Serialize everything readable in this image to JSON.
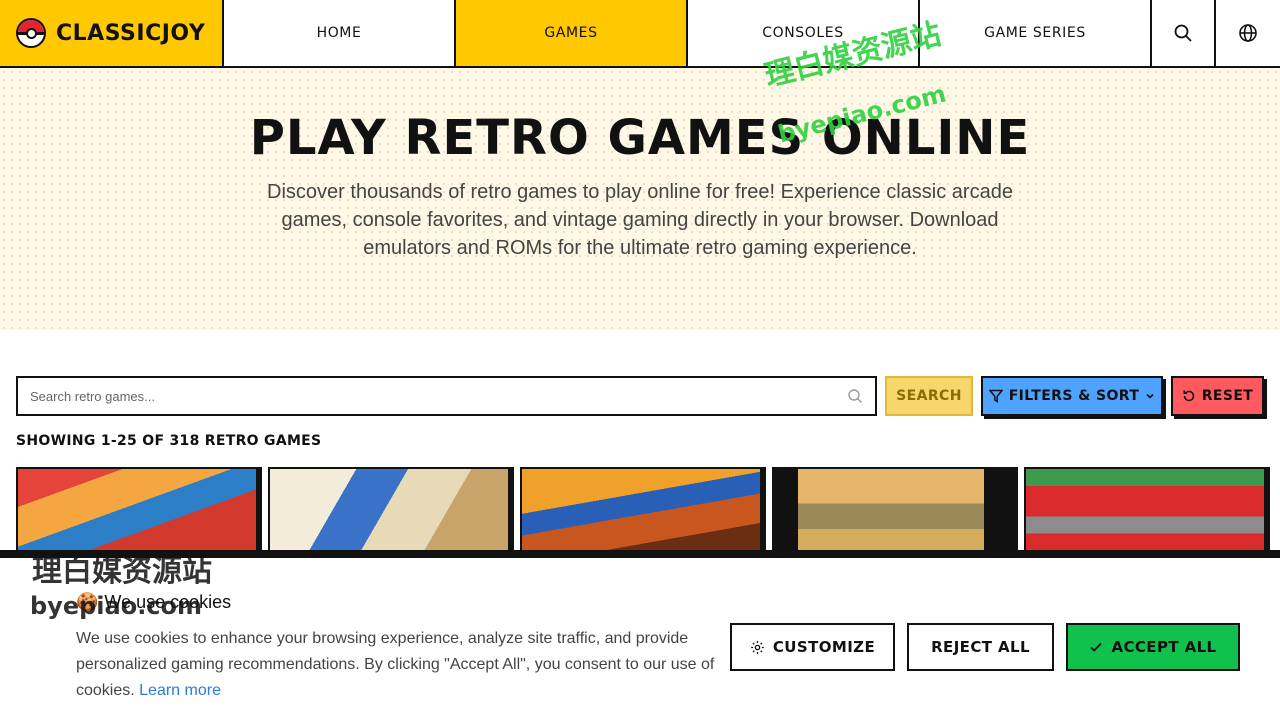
{
  "header": {
    "logo_text": "CLASSICJOY",
    "nav": [
      {
        "label": "HOME",
        "active": false
      },
      {
        "label": "GAMES",
        "active": true
      },
      {
        "label": "CONSOLES",
        "active": false
      },
      {
        "label": "GAME SERIES",
        "active": false
      }
    ],
    "icons": [
      "search-icon",
      "globe-icon"
    ]
  },
  "hero": {
    "title": "PLAY RETRO GAMES ONLINE",
    "description": "Discover thousands of retro games to play online for free! Experience classic arcade games, console favorites, and vintage gaming directly in your browser. Download emulators and ROMs for the ultimate retro gaming experience."
  },
  "toolbar": {
    "search_placeholder": "Search retro games...",
    "search_label": "SEARCH",
    "filters_label": "FILTERS & SORT",
    "reset_label": "RESET"
  },
  "results": {
    "count_text": "SHOWING 1-25 OF 318 RETRO GAMES"
  },
  "cookie": {
    "title": "We use cookies",
    "description": "We use cookies to enhance your browsing experience, analyze site traffic, and provide personalized gaming recommendations. By clicking \"Accept All\", you consent to our use of cookies.",
    "learn_more": "Learn more",
    "customize_label": "CUSTOMIZE",
    "reject_label": "REJECT ALL",
    "accept_label": "ACCEPT ALL"
  },
  "watermark": {
    "cn_text": "理白媒资源站",
    "en_text": "byepiao.com"
  },
  "colors": {
    "brand_yellow": "#ffc800",
    "filters_blue": "#4da3ff",
    "reset_red": "#ff5a5f",
    "accept_green": "#10c24d",
    "link_blue": "#2a7be4"
  }
}
